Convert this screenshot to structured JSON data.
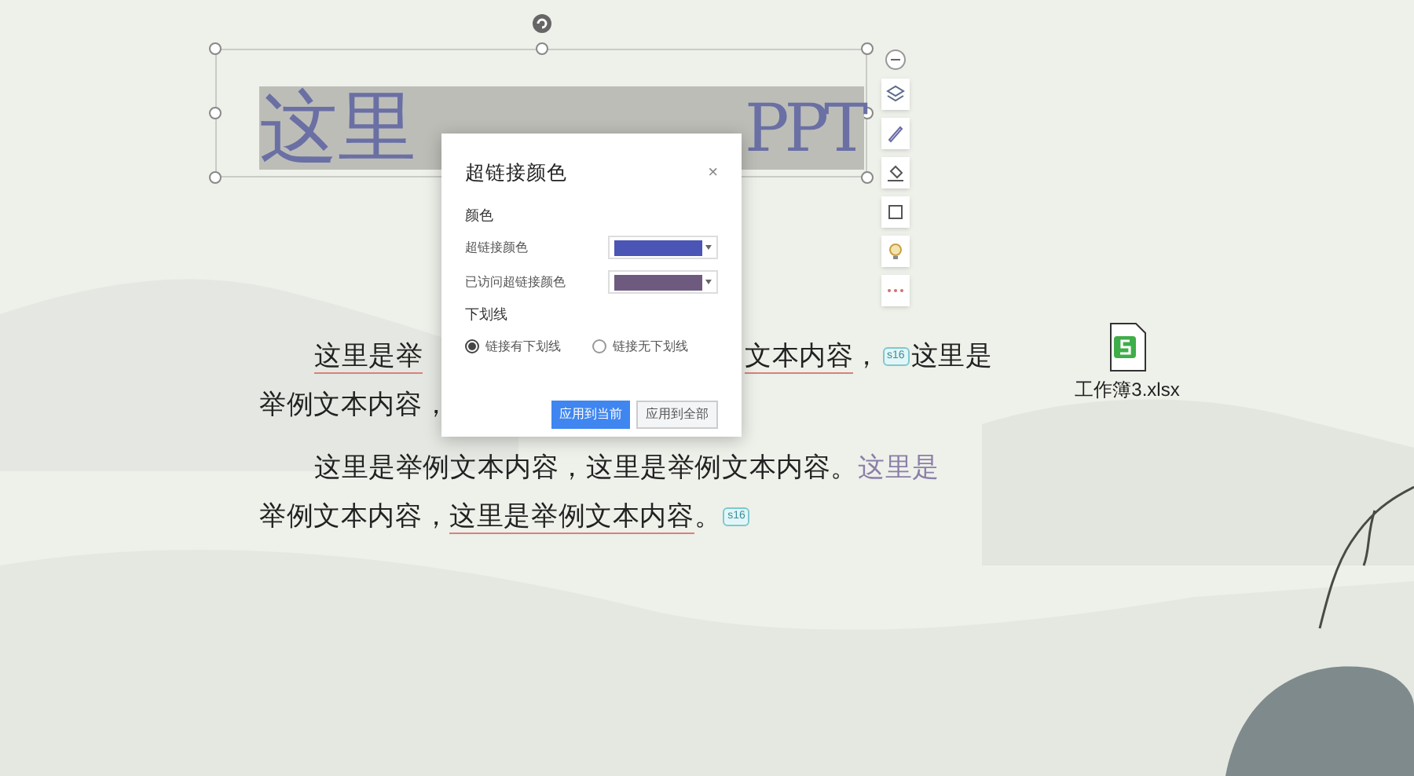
{
  "title_parts": [
    "这里",
    "PPT"
  ],
  "lines": [
    {
      "indent": true,
      "left": [
        {
          "kind": "text",
          "text": "这里是举",
          "underline": true
        }
      ],
      "right": [
        {
          "kind": "text",
          "text": "文本内容",
          "underline": true
        },
        {
          "kind": "text",
          "text": "，",
          "underline": false
        },
        {
          "kind": "comment",
          "text": "s16"
        },
        {
          "kind": "text",
          "text": "这里是",
          "underline": false
        }
      ]
    },
    {
      "indent": false,
      "left": [
        {
          "kind": "text",
          "text": "举例文本内容，",
          "underline": false
        }
      ]
    },
    {
      "indent": true,
      "left": [
        {
          "kind": "text",
          "text": "这里是举例文本内容，这里是举例文本内容。",
          "underline": false
        },
        {
          "kind": "link",
          "text": "这里是",
          "underline": false
        }
      ]
    },
    {
      "indent": false,
      "left": [
        {
          "kind": "text",
          "text": "举例文本内容，",
          "underline": false
        },
        {
          "kind": "text",
          "text": "这里是举例文本内容",
          "underline": true
        },
        {
          "kind": "text",
          "text": "。",
          "underline": false
        },
        {
          "kind": "comment",
          "text": "s16"
        }
      ]
    }
  ],
  "file": {
    "name": "工作簿3.xlsx"
  },
  "dialog": {
    "title": "超链接颜色",
    "close": "×",
    "color_section": "颜色",
    "fields": [
      {
        "label": "超链接颜色",
        "color": "#4a55b5"
      },
      {
        "label": "已访问超链接颜色",
        "color": "#6e5a7e"
      }
    ],
    "underline_section": "下划线",
    "options": [
      {
        "label": "链接有下划线",
        "selected": true
      },
      {
        "label": "链接无下划线",
        "selected": false
      }
    ],
    "buttons": [
      {
        "label": "应用到当前",
        "primary": true
      },
      {
        "label": "应用到全部",
        "primary": false
      }
    ]
  }
}
